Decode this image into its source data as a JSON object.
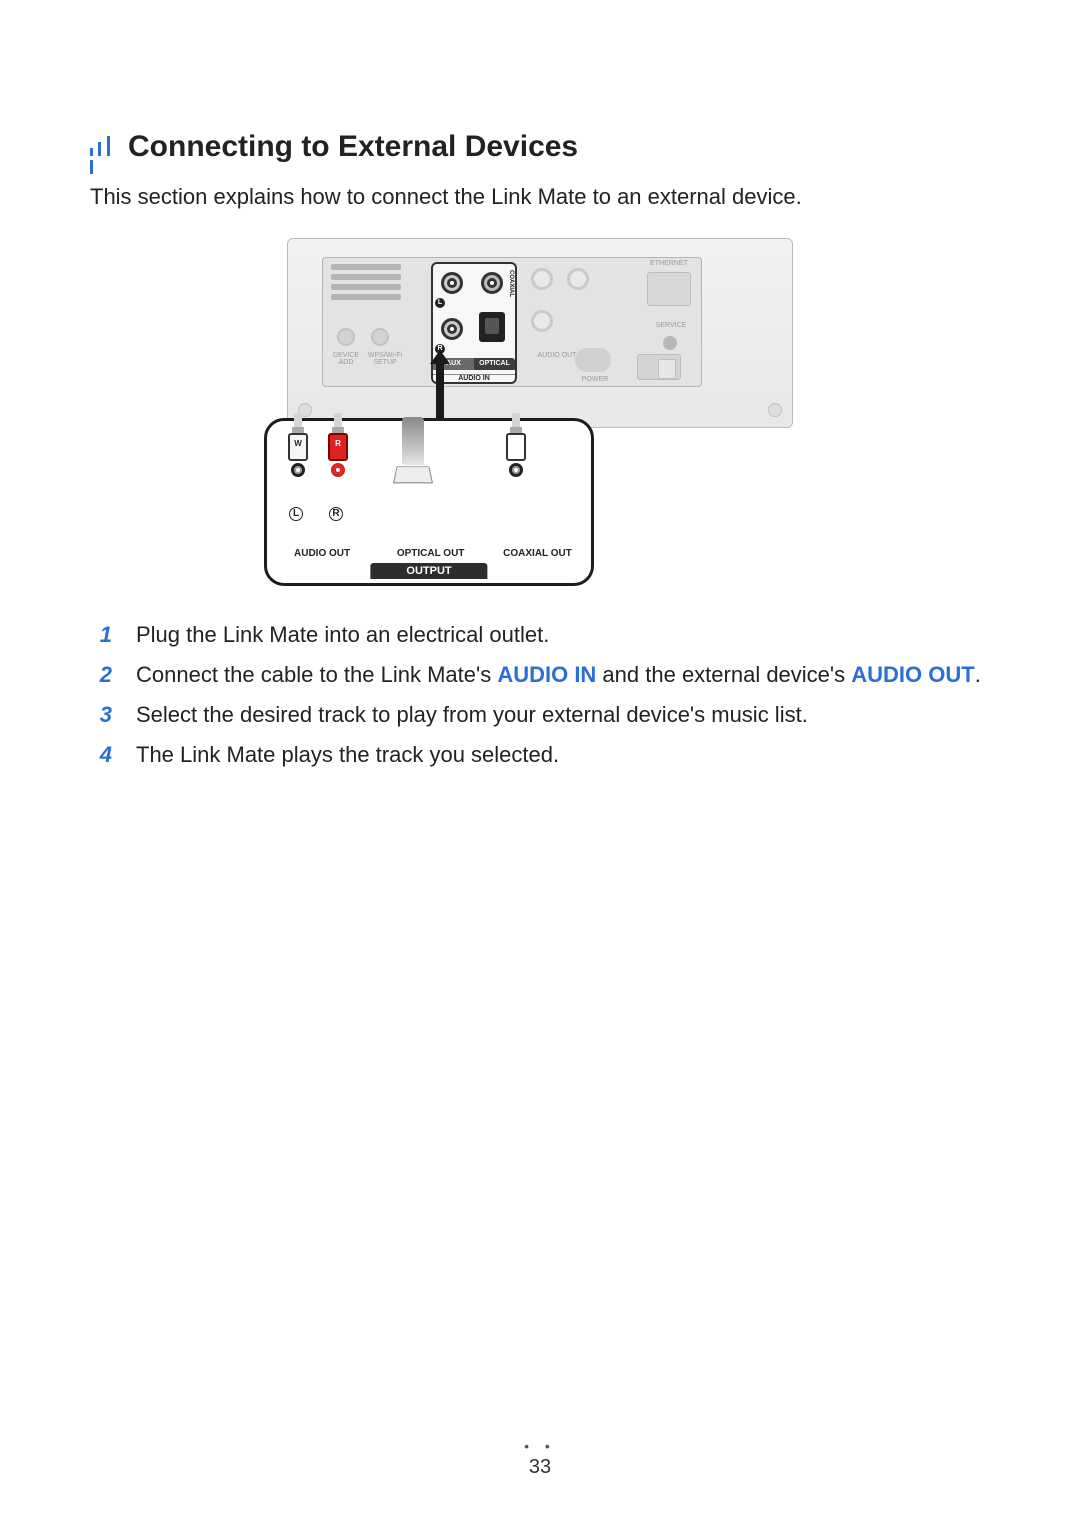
{
  "heading": "Connecting to External Devices",
  "intro": "This section explains how to connect the Link Mate to an external device.",
  "panel": {
    "device_add": "DEVICE\nADD",
    "wps_wifi": "WPS/Wi-Fi\nSETUP",
    "aux": "AUX",
    "optical": "OPTICAL",
    "coaxial": "COAXIAL",
    "audio_in": "AUDIO IN",
    "audio_out_faded": "AUDIO OUT",
    "ethernet": "ETHERNET",
    "service": "SERVICE",
    "power": "POWER",
    "l_badge": "L",
    "r_badge": "R"
  },
  "callout": {
    "w": "W",
    "r": "R",
    "L": "L",
    "R": "R",
    "audio_out": "AUDIO OUT",
    "optical_out": "OPTICAL OUT",
    "coaxial_out": "COAXIAL OUT",
    "output": "OUTPUT"
  },
  "steps": [
    {
      "n": "1",
      "text": "Plug the Link Mate into an electrical outlet."
    },
    {
      "n": "2",
      "prefix": "Connect the cable to the Link Mate's ",
      "accent1": "AUDIO IN",
      "mid": " and the external device's ",
      "accent2": "AUDIO OUT",
      "suffix": "."
    },
    {
      "n": "3",
      "text": "Select the desired track to play from your external device's music list."
    },
    {
      "n": "4",
      "text": "The Link Mate plays the track you selected."
    }
  ],
  "page_number": "33"
}
